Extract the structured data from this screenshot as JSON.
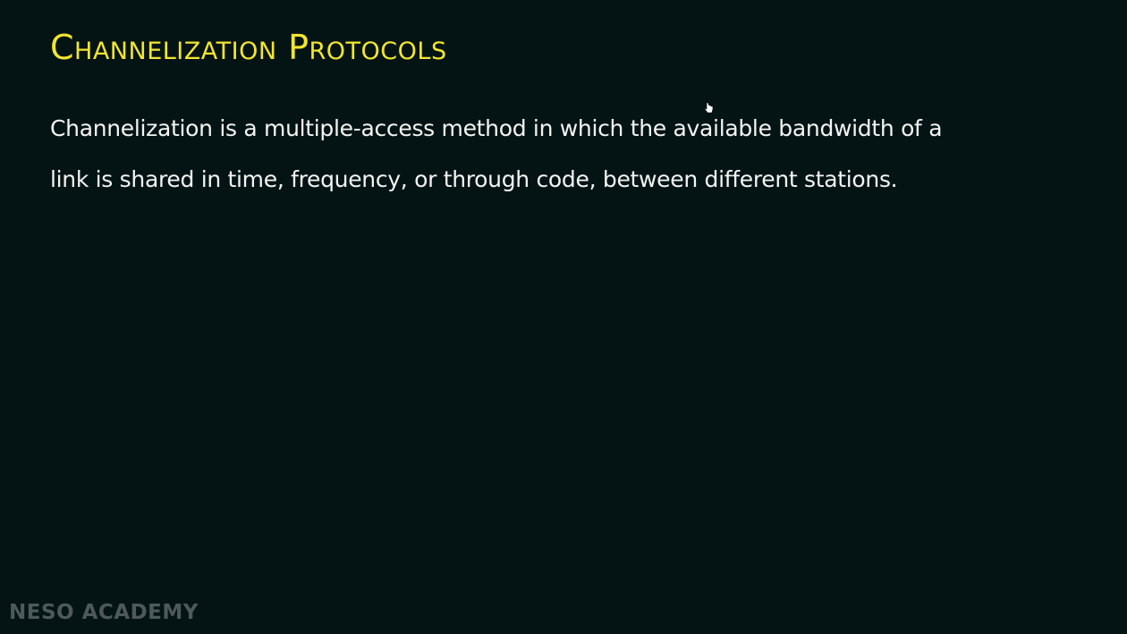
{
  "slide": {
    "title": "Channelization Protocols",
    "body_lines": [
      "Channelization is a multiple-access method in which the available bandwidth of a",
      "link is shared in time, frequency, or through code, between different stations."
    ],
    "watermark": "NESO ACADEMY"
  },
  "colors": {
    "background": "#041414",
    "title": "#f2e530",
    "text": "#f4f4f4",
    "watermark": "#5b6666"
  },
  "icons": {
    "cursor": "hand-pointer-icon"
  }
}
